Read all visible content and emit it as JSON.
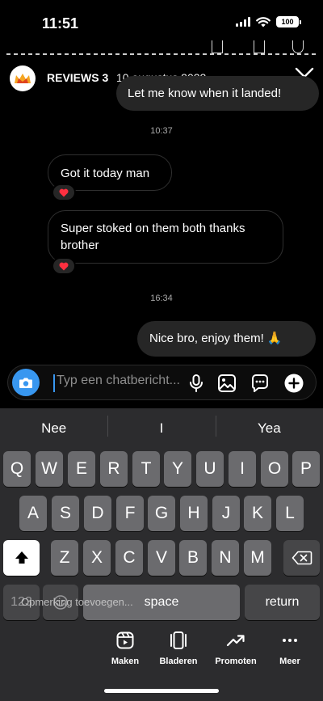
{
  "status_bar": {
    "time": "11:51",
    "battery": "100",
    "icons": [
      "cellular-signal-icon",
      "wifi-icon",
      "battery-icon"
    ]
  },
  "story_header": {
    "name": "REVIEWS 3",
    "date": "10 augustus 2022",
    "close_icon": "close-icon"
  },
  "messages": [
    {
      "direction": "outgoing",
      "text": "Let me know when it landed!"
    },
    {
      "type": "timestamp",
      "text": "10:37"
    },
    {
      "direction": "incoming",
      "text": "Got it today man",
      "reaction": "❤️"
    },
    {
      "direction": "incoming",
      "text": "Super stoked on them both thanks brother",
      "reaction": "❤️"
    },
    {
      "type": "timestamp",
      "text": "16:34"
    },
    {
      "direction": "outgoing",
      "text": "Nice bro, enjoy them! 🙏"
    }
  ],
  "composer": {
    "placeholder": "Typ een chatbericht...",
    "icons": [
      "camera-icon",
      "microphone-icon",
      "gallery-icon",
      "sticker-icon",
      "add-icon"
    ]
  },
  "keyboard": {
    "suggestions": [
      "Nee",
      "I",
      "Yea"
    ],
    "row1": [
      "Q",
      "W",
      "E",
      "R",
      "T",
      "Y",
      "U",
      "I",
      "O",
      "P"
    ],
    "row2": [
      "A",
      "S",
      "D",
      "F",
      "G",
      "H",
      "J",
      "K",
      "L"
    ],
    "row3": [
      "Z",
      "X",
      "C",
      "V",
      "B",
      "N",
      "M"
    ],
    "numbers_key": "123",
    "space_key": "space",
    "return_key": "return",
    "caption_hint": "Opmerking toevoegen..."
  },
  "bottom_bar": [
    {
      "label": "Maken",
      "icon": "reels-icon"
    },
    {
      "label": "Bladeren",
      "icon": "carousel-icon"
    },
    {
      "label": "Promoten",
      "icon": "trending-icon"
    },
    {
      "label": "Meer",
      "icon": "more-icon"
    }
  ],
  "colors": {
    "background": "#000000",
    "accent": "#3897f0",
    "bubble_outgoing": "#262626",
    "keyboard_bg": "#2c2c2e",
    "key_bg": "#6b6b6e"
  }
}
